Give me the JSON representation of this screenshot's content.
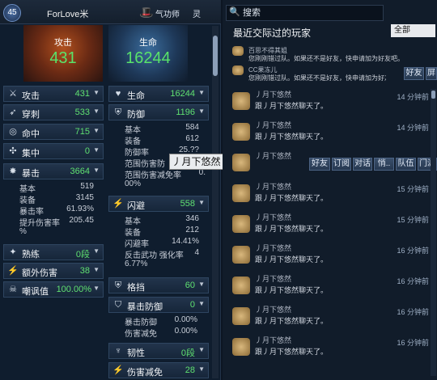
{
  "header": {
    "level": "45",
    "player_name": "ForLove米",
    "class_name": "气功师",
    "class_suffix": "灵"
  },
  "big": {
    "attack_label": "攻击",
    "attack_value": "431",
    "hp_label": "生命",
    "hp_value": "16244"
  },
  "left_rows": {
    "attack": {
      "label": "攻击",
      "value": "431"
    },
    "pierce": {
      "label": "穿刺",
      "value": "533"
    },
    "hit": {
      "label": "命中",
      "value": "715"
    },
    "focus": {
      "label": "集中",
      "value": "0"
    },
    "crit": {
      "label": "暴击",
      "value": "3664"
    },
    "crit_base": {
      "label": "基本",
      "value": "519"
    },
    "crit_equip": {
      "label": "装备",
      "value": "3145"
    },
    "crit_rate": {
      "label": "暴击率",
      "value": "61.93%"
    },
    "crit_dmg_label": "提升伤害率",
    "crit_dmg_value": "205.45",
    "crit_dmg_unit": "%",
    "mastery": {
      "label": "熟练",
      "value": "0段"
    },
    "extra_dmg": {
      "label": "额外伤害",
      "value": "38"
    },
    "mock": {
      "label": "嘲讽值",
      "value": "100.00%"
    }
  },
  "mid_rows": {
    "hp": {
      "label": "生命",
      "value": "16244"
    },
    "defense": {
      "label": "防御",
      "value": "1196"
    },
    "def_base": {
      "label": "基本",
      "value": "584"
    },
    "def_equip": {
      "label": "装备",
      "value": "612"
    },
    "def_rate_label": "防御率",
    "def_rate_value": "25.??",
    "range_def_label": "范围伤害防",
    "range_reduce_label": "范围伤害减免率",
    "range_reduce_value": "0.",
    "zero_pct": "00%",
    "evade": {
      "label": "闪避",
      "value": "558"
    },
    "ev_base": {
      "label": "基本",
      "value": "346"
    },
    "ev_equip": {
      "label": "装备",
      "value": "212"
    },
    "ev_rate": {
      "label": "闪避率",
      "value": "14.41%"
    },
    "counter_label": "反击武功 强化率",
    "counter_value": "4",
    "counter_pct": "6.77%",
    "block": {
      "label": "格挡",
      "value": "60"
    },
    "crit_def": {
      "label": "暴击防御",
      "value": "0"
    },
    "cd_def": {
      "label": "暴击防御",
      "value": "0.00%"
    },
    "cd_reduce": {
      "label": "伤害减免",
      "value": "0.00%"
    },
    "tough": {
      "label": "韧性",
      "value": "0段"
    },
    "dmg_reduce": {
      "label": "伤害减免",
      "value": "28"
    }
  },
  "tooltip": "丿月下悠然",
  "right": {
    "search_placeholder": "搜索",
    "title": "最近交际过的玩家",
    "filter": "全部",
    "notice1_name": "百思不得其姐",
    "notice1_text": "您刚刚错过队。如果还不是好友，快申请加为好友吧。",
    "notice2_name": "CC果冻儿",
    "notice2_text": "您刚刚错过队。如果还不是好友，快申请加为好友吧。",
    "btn_friend_small": "好友",
    "btn_block_small": "屏蔽",
    "messages": [
      {
        "name": "丿月下悠然",
        "text": "跟丿月下悠然聊天了。",
        "time": "14 分钟前"
      },
      {
        "name": "丿月下悠然",
        "text": "跟丿月下悠然聊天了。",
        "time": "14 分钟前"
      },
      {
        "name": "丿月下悠然",
        "text": "",
        "time": ""
      },
      {
        "name": "丿月下悠然",
        "text": "跟丿月下悠然聊天了。",
        "time": "15 分钟前"
      },
      {
        "name": "丿月下悠然",
        "text": "跟丿月下悠然聊天了。",
        "time": "15 分钟前"
      },
      {
        "name": "丿月下悠然",
        "text": "跟丿月下悠然聊天了。",
        "time": "16 分钟前"
      },
      {
        "name": "丿月下悠然",
        "text": "跟丿月下悠然聊天了。",
        "time": "16 分钟前"
      },
      {
        "name": "丿月下悠然",
        "text": "跟丿月下悠然聊天了。",
        "time": "16 分钟前"
      },
      {
        "name": "丿月下悠然",
        "text": "跟丿月下悠然聊天了。",
        "time": "16 分钟前"
      }
    ],
    "action_buttons": [
      "好友",
      "订阅",
      "对话",
      "悄..",
      "队伍",
      "门派"
    ]
  }
}
